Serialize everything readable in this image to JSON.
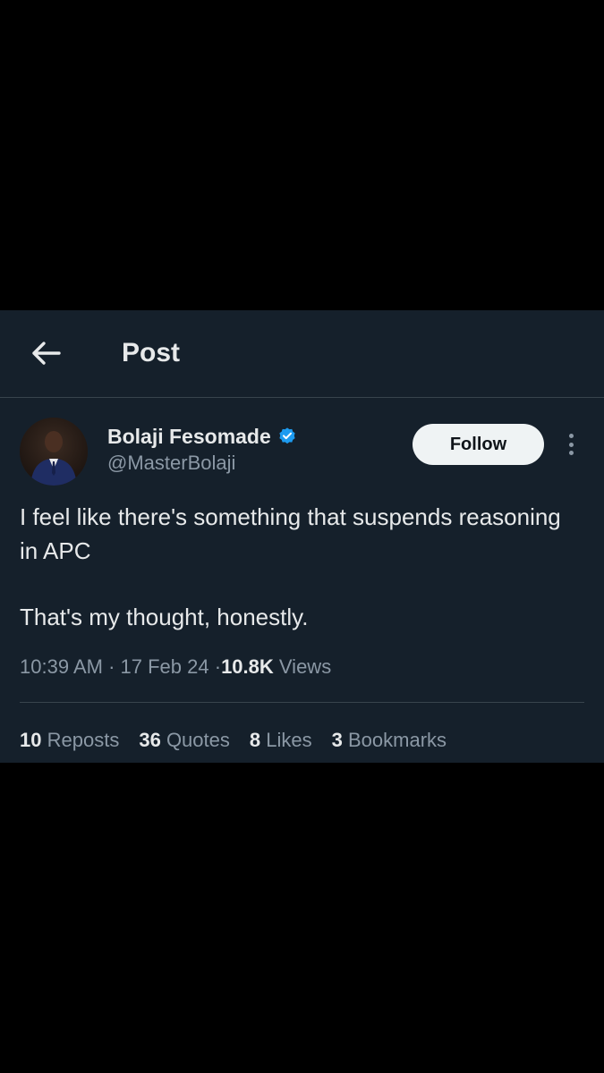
{
  "header": {
    "title": "Post",
    "back_icon": "arrow-left-icon"
  },
  "author": {
    "display_name": "Bolaji Fesomade",
    "handle": "@MasterBolaji",
    "verified": true,
    "verified_icon": "verified-badge-icon"
  },
  "follow_label": "Follow",
  "more_icon": "more-vertical-icon",
  "post": {
    "text_lines": [
      "I feel like there's something that suspends reasoning in APC",
      "That's my thought, honestly."
    ],
    "time": "10:39 AM",
    "date": "17 Feb 24",
    "separator": "·",
    "views_count": "10.8K",
    "views_label": "Views"
  },
  "stats": [
    {
      "count": "10",
      "label": "Reposts"
    },
    {
      "count": "36",
      "label": "Quotes"
    },
    {
      "count": "8",
      "label": "Likes"
    },
    {
      "count": "3",
      "label": "Bookmarks"
    }
  ],
  "colors": {
    "background": "#15202b",
    "outer": "#000000",
    "text": "#e7e9ea",
    "secondary": "#8b98a5",
    "verified": "#1d9bf0",
    "divider": "#38444d"
  }
}
